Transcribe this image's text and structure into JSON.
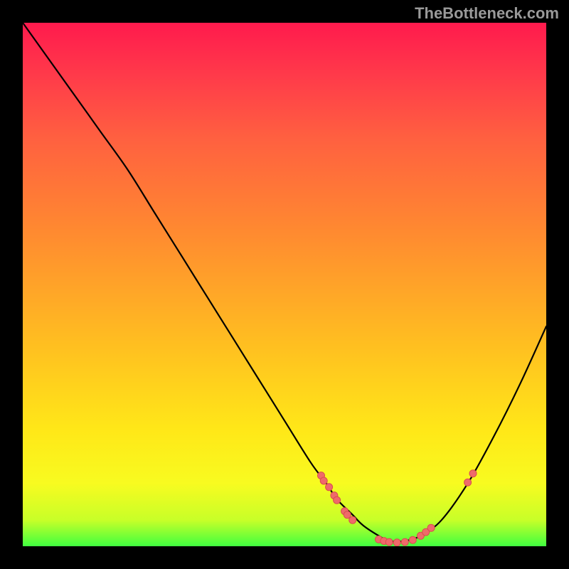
{
  "watermark": "TheBottleneck.com",
  "chart_data": {
    "type": "line",
    "title": "",
    "xlabel": "",
    "ylabel": "",
    "x": [
      0.0,
      0.05,
      0.1,
      0.15,
      0.2,
      0.25,
      0.3,
      0.35,
      0.4,
      0.45,
      0.5,
      0.55,
      0.58,
      0.6,
      0.63,
      0.65,
      0.68,
      0.7,
      0.73,
      0.76,
      0.8,
      0.85,
      0.9,
      0.95,
      1.0
    ],
    "y": [
      1.0,
      0.93,
      0.86,
      0.79,
      0.72,
      0.64,
      0.56,
      0.48,
      0.4,
      0.32,
      0.24,
      0.16,
      0.12,
      0.09,
      0.06,
      0.04,
      0.02,
      0.01,
      0.01,
      0.02,
      0.05,
      0.12,
      0.21,
      0.31,
      0.42
    ],
    "xlim": [
      0,
      1
    ],
    "ylim": [
      0,
      1
    ],
    "grid": false,
    "markers": [
      {
        "x": 0.57,
        "y": 0.135
      },
      {
        "x": 0.575,
        "y": 0.125
      },
      {
        "x": 0.585,
        "y": 0.113
      },
      {
        "x": 0.595,
        "y": 0.097
      },
      {
        "x": 0.6,
        "y": 0.088
      },
      {
        "x": 0.615,
        "y": 0.067
      },
      {
        "x": 0.62,
        "y": 0.06
      },
      {
        "x": 0.63,
        "y": 0.05
      },
      {
        "x": 0.68,
        "y": 0.013
      },
      {
        "x": 0.69,
        "y": 0.01
      },
      {
        "x": 0.7,
        "y": 0.008
      },
      {
        "x": 0.715,
        "y": 0.007
      },
      {
        "x": 0.73,
        "y": 0.008
      },
      {
        "x": 0.745,
        "y": 0.012
      },
      {
        "x": 0.76,
        "y": 0.02
      },
      {
        "x": 0.77,
        "y": 0.027
      },
      {
        "x": 0.78,
        "y": 0.035
      },
      {
        "x": 0.85,
        "y": 0.122
      },
      {
        "x": 0.86,
        "y": 0.139
      }
    ],
    "gradient_colors": {
      "top": "#ff1a4d",
      "mid_upper": "#ff8a30",
      "mid_lower": "#ffe818",
      "bottom": "#40ff40"
    }
  }
}
